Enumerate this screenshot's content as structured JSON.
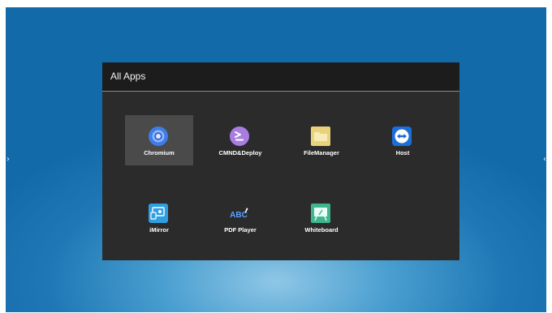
{
  "nav": {
    "left_arrow": "›",
    "right_arrow": "‹"
  },
  "dialog": {
    "title": "All Apps"
  },
  "apps": [
    {
      "label": "Chromium",
      "icon": "chromium-icon",
      "selected": true
    },
    {
      "label": "CMND&Deploy",
      "icon": "cmnd-deploy-icon",
      "selected": false
    },
    {
      "label": "FileManager",
      "icon": "folder-icon",
      "selected": false
    },
    {
      "label": "Host",
      "icon": "teamviewer-host-icon",
      "selected": false
    },
    {
      "label": "iMirror",
      "icon": "imirror-icon",
      "selected": false
    },
    {
      "label": "PDF Player",
      "icon": "pdf-player-icon",
      "selected": false
    },
    {
      "label": "Whiteboard",
      "icon": "whiteboard-icon",
      "selected": false
    }
  ],
  "pdf_icon_text": "ABC",
  "colors": {
    "background": "#1f78b5",
    "dialog": "#2b2b2b",
    "dialog_header": "#1c1c1c",
    "selection": "#4a4a4a",
    "chromium": "#3e7de8",
    "cmnd": "#a87de0",
    "folder": "#e8d27a",
    "teamviewer": "#1a6fd8",
    "imirror": "#2f9fe0",
    "pdf": "#5aa0ff",
    "whiteboard": "#3fb68e"
  }
}
